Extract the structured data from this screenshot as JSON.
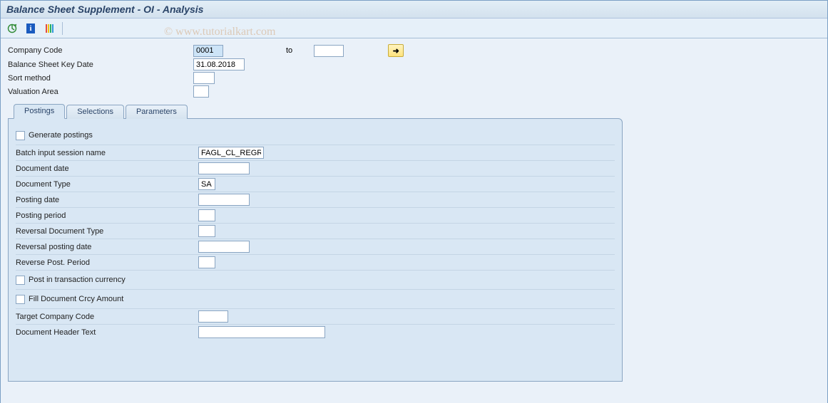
{
  "header": {
    "title": "Balance Sheet Supplement - OI - Analysis"
  },
  "watermark": "© www.tutorialkart.com",
  "selection": {
    "company_code": {
      "label": "Company Code",
      "value_from": "0001",
      "to_label": "to",
      "value_to": ""
    },
    "key_date": {
      "label": "Balance Sheet Key Date",
      "value": "31.08.2018"
    },
    "sort_method": {
      "label": "Sort method",
      "value": ""
    },
    "valuation_area": {
      "label": "Valuation Area",
      "value": ""
    }
  },
  "tabs": {
    "postings": "Postings",
    "selections": "Selections",
    "parameters": "Parameters"
  },
  "postings_tab": {
    "generate_postings_label": "Generate postings",
    "batch_session": {
      "label": "Batch input session name",
      "value": "FAGL_CL_REGR"
    },
    "doc_date": {
      "label": "Document date",
      "value": ""
    },
    "doc_type": {
      "label": "Document Type",
      "value": "SA"
    },
    "posting_date": {
      "label": "Posting date",
      "value": ""
    },
    "posting_period": {
      "label": "Posting period",
      "value": ""
    },
    "rev_doc_type": {
      "label": "Reversal Document Type",
      "value": ""
    },
    "rev_posting_date": {
      "label": "Reversal posting date",
      "value": ""
    },
    "rev_post_period": {
      "label": "Reverse Post. Period",
      "value": ""
    },
    "post_tx_currency_label": "Post in transaction currency",
    "fill_doc_crcy_label": "Fill Document Crcy Amount",
    "target_cc": {
      "label": "Target Company Code",
      "value": ""
    },
    "header_text": {
      "label": "Document Header Text",
      "value": ""
    }
  }
}
